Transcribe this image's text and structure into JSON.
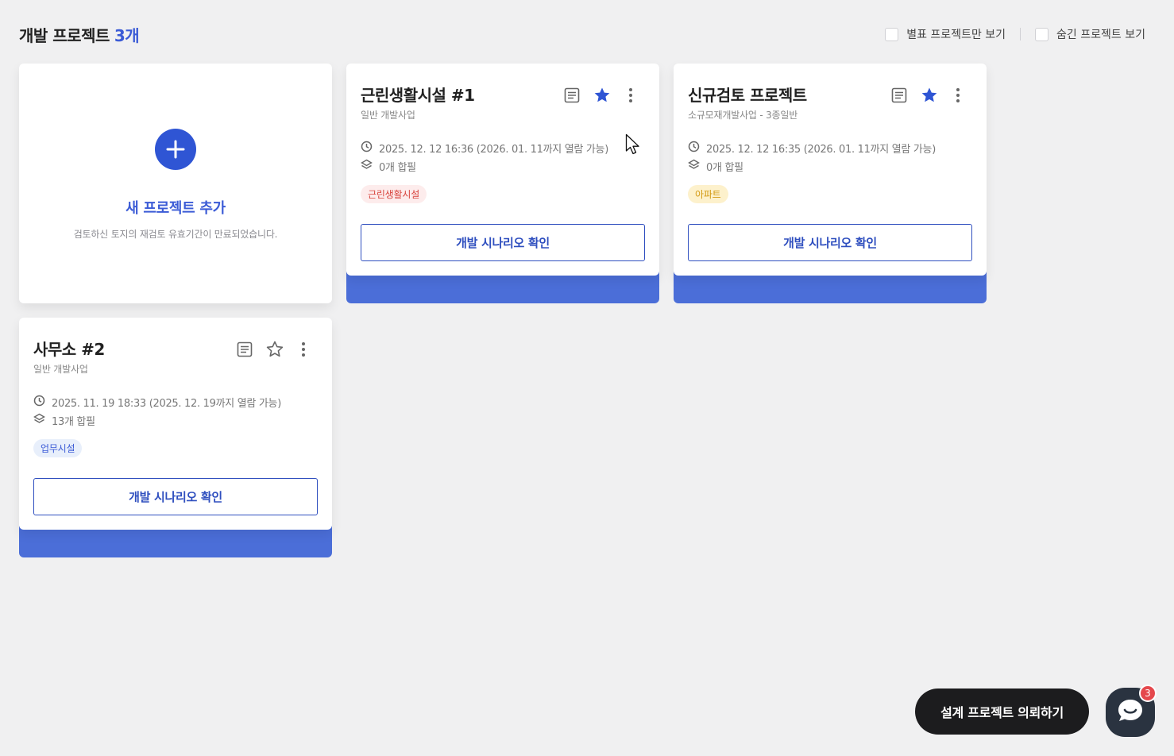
{
  "header": {
    "title": "개발 프로젝트",
    "count": "3개",
    "filters": [
      {
        "label": "별표 프로젝트만 보기",
        "checked": false
      },
      {
        "label": "숨긴 프로젝트 보기",
        "checked": false
      }
    ]
  },
  "new_project": {
    "title": "새 프로젝트 추가",
    "subtitle": "검토하신 토지의 재검토 유효기간이 만료되었습니다.",
    "icon": "plus-icon"
  },
  "projects": [
    {
      "title": "근린생활시설 #1",
      "subtitle": "일반 개발사업",
      "datetime": "2025. 12. 12 16:36 (2026. 01. 11까지 열람 가능)",
      "merge": "0개 합필",
      "tag": "근린생활시설",
      "tag_color": "#d8453e",
      "starred": true,
      "cta": "개발 시나리오 확인"
    },
    {
      "title": "신규검토 프로젝트",
      "subtitle": "소규모재개발사업 - 3종일반",
      "datetime": "2025. 12. 12 16:35 (2026. 01. 11까지 열람 가능)",
      "merge": "0개 합필",
      "tag": "아파트",
      "tag_color": "#d39a14",
      "starred": true,
      "cta": "개발 시나리오 확인"
    },
    {
      "title": "사무소 #2",
      "subtitle": "일반 개발사업",
      "datetime": "2025. 11. 19 18:33 (2025. 12. 19까지 열람 가능)",
      "merge": "13개 합필",
      "tag": "업무시설",
      "tag_color": "#3b5bd6",
      "starred": false,
      "cta": "개발 시나리오 확인"
    }
  ],
  "footer": {
    "request_label": "설계 프로젝트 의뢰하기",
    "chat_badge": "3"
  },
  "colors": {
    "accent": "#3b5bd6",
    "card_underlay": "#4b6ed8",
    "background": "#f0f0f1"
  }
}
